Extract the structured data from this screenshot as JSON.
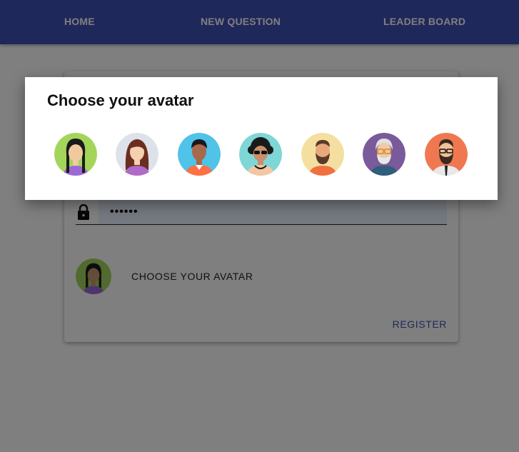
{
  "nav": {
    "items": [
      {
        "label": "HOME"
      },
      {
        "label": "NEW QUESTION"
      },
      {
        "label": "LEADER BOARD"
      }
    ]
  },
  "form": {
    "password_value": "••••••",
    "choose_avatar_label": "CHOOSE YOUR AVATAR",
    "register_label": "REGISTER",
    "selected_avatar": "avatar-1"
  },
  "dialog": {
    "title": "Choose your avatar",
    "avatars": [
      {
        "name": "avatar-1",
        "bg": "#a3d55a"
      },
      {
        "name": "avatar-2",
        "bg": "#dde2ea"
      },
      {
        "name": "avatar-3",
        "bg": "#4fc3e8"
      },
      {
        "name": "avatar-4",
        "bg": "#7ed6d6"
      },
      {
        "name": "avatar-5",
        "bg": "#f5dfa0"
      },
      {
        "name": "avatar-6",
        "bg": "#7a5a9a"
      },
      {
        "name": "avatar-7",
        "bg": "#f07850"
      }
    ]
  },
  "colors": {
    "navbar": "#3f51b5",
    "accent": "#3f51b5",
    "backdrop": "rgba(0,0,0,0.5)"
  }
}
